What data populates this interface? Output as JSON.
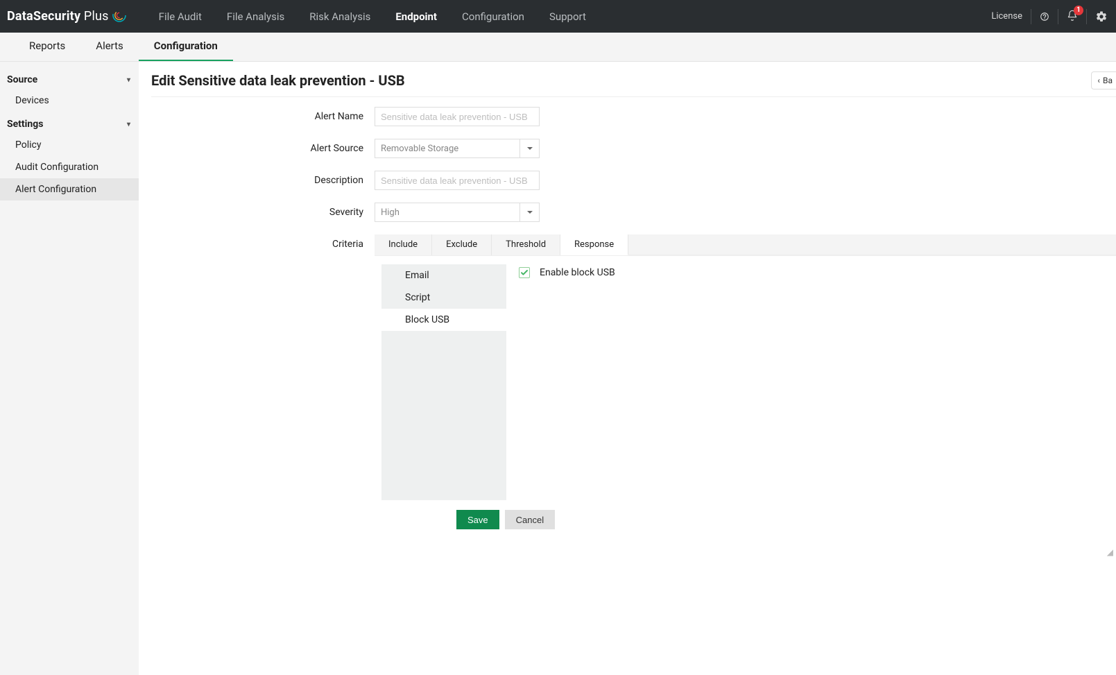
{
  "brand": {
    "bold": "DataSecurity",
    "light": " Plus"
  },
  "topnav": {
    "items": [
      "File Audit",
      "File Analysis",
      "Risk Analysis",
      "Endpoint",
      "Configuration",
      "Support"
    ],
    "active_index": 3
  },
  "topright": {
    "license": "License",
    "notif_count": "1"
  },
  "subtabs": {
    "items": [
      "Reports",
      "Alerts",
      "Configuration"
    ],
    "active_index": 2
  },
  "sidebar": {
    "sections": [
      {
        "title": "Source",
        "items": [
          "Devices"
        ],
        "active_item": -1
      },
      {
        "title": "Settings",
        "items": [
          "Policy",
          "Audit Configuration",
          "Alert Configuration"
        ],
        "active_item": 2
      }
    ]
  },
  "page": {
    "title": "Edit Sensitive data leak prevention - USB",
    "back_label": "Ba"
  },
  "form": {
    "alert_name": {
      "label": "Alert Name",
      "placeholder": "Sensitive data leak prevention - USB",
      "value": ""
    },
    "alert_source": {
      "label": "Alert Source",
      "value": "Removable Storage"
    },
    "description": {
      "label": "Description",
      "placeholder": "Sensitive data leak prevention - USB",
      "value": ""
    },
    "severity": {
      "label": "Severity",
      "value": "High"
    },
    "criteria_label": "Criteria"
  },
  "criteria_tabs": {
    "items": [
      "Include",
      "Exclude",
      "Threshold",
      "Response"
    ],
    "active_index": 3
  },
  "response": {
    "side_items": [
      "Email",
      "Script",
      "Block USB"
    ],
    "active_index": 2,
    "enable_block_usb": {
      "label": "Enable block USB",
      "checked": true
    }
  },
  "buttons": {
    "save": "Save",
    "cancel": "Cancel"
  }
}
